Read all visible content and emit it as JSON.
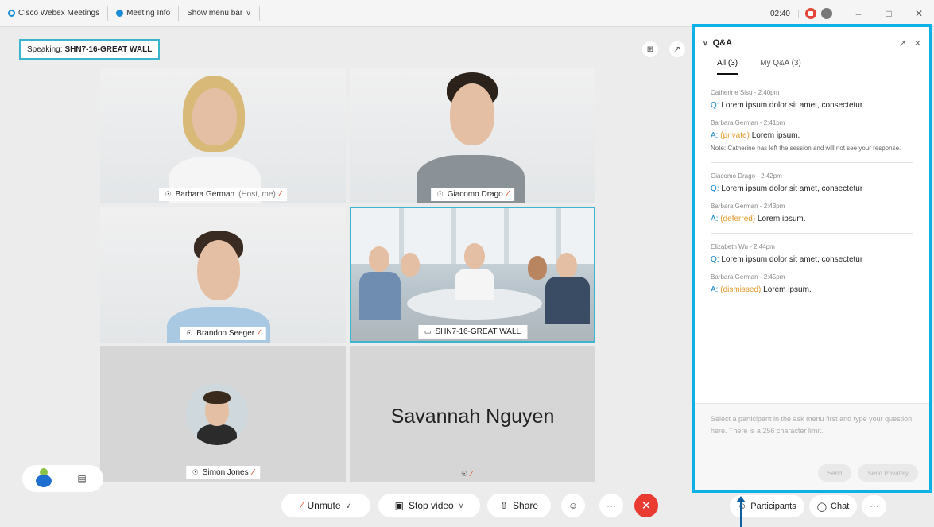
{
  "titlebar": {
    "app_name": "Cisco Webex Meetings",
    "meeting_info": "Meeting Info",
    "show_menu_bar": "Show menu bar",
    "time": "02:40",
    "minimize": "–",
    "maximize": "□",
    "close": "✕"
  },
  "stage": {
    "speaking_prefix": "Speaking:",
    "speaking_name": "SHN7-16-GREAT WALL",
    "layout_icon": "⊞",
    "popout_icon": "↗"
  },
  "tiles": [
    {
      "name": "Barbara German",
      "suffix": "(Host, me)"
    },
    {
      "name": "Giacomo Drago"
    },
    {
      "name": "Brandon Seeger"
    },
    {
      "name": "SHN7-16-GREAT WALL"
    },
    {
      "name": "Simon Jones"
    },
    {
      "name": "Savannah Nguyen"
    }
  ],
  "controls": {
    "unmute": "Unmute",
    "stop_video": "Stop video",
    "share": "Share",
    "more": "···",
    "end": "✕",
    "participants": "Participants",
    "chat": "Chat"
  },
  "qa": {
    "title": "Q&A",
    "tabs": [
      "All (3)",
      "My Q&A (3)"
    ],
    "items": [
      {
        "asker_meta": "Catherine Sisu - 2:40pm",
        "question": "Lorem ipsum dolor sit amet, consectetur",
        "answerer_meta": "Barbara German - 2:41pm",
        "status": "(private)",
        "answer": "Lorem ipsum.",
        "note": "Note: Catherine has left the session and will not see your response."
      },
      {
        "asker_meta": "Giacomo Drago - 2:42pm",
        "question": "Lorem ipsum dolor sit amet, consectetur",
        "answerer_meta": "Barbara German - 2:43pm",
        "status": "(deferred)",
        "answer": "Lorem ipsum."
      },
      {
        "asker_meta": "Elizabeth Wu - 2:44pm",
        "question": "Lorem ipsum dolor sit amet, consectetur",
        "answerer_meta": "Barbara German - 2:45pm",
        "status": "(dismissed)",
        "answer": "Lorem ipsum."
      }
    ],
    "q_prefix": "Q:",
    "a_prefix": "A:",
    "input_placeholder": "Select a participant in the ask menu first and type your question here. There is a 256 character limit.",
    "send": "Send",
    "send_privately": "Send Privately"
  },
  "colors": {
    "accent_cyan": "#0eb1e6",
    "active_tile": "#3bb5ce",
    "mute_red": "#e25a3a",
    "end_red": "#ea3b33",
    "status_orange": "#e49a2a",
    "link_blue": "#1287c9"
  }
}
